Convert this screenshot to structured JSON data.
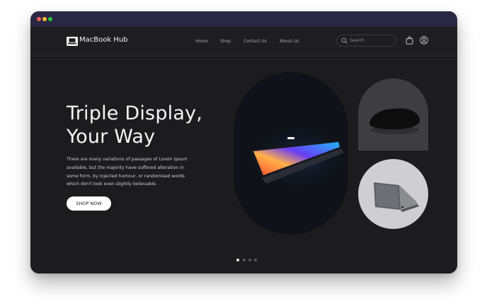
{
  "brand": {
    "name": "MacBook Hub",
    "logo_icon": "laptop-badge-icon"
  },
  "nav": {
    "links": [
      "Home",
      "Shop",
      "Contact Us",
      "About Us"
    ],
    "search_placeholder": "Search",
    "icons": [
      "search-icon",
      "shopping-bag-icon",
      "user-circle-icon"
    ]
  },
  "hero": {
    "title_line1": "Triple Display,",
    "title_line2": "Your Way",
    "description": "There are many variations of passages of Lorem Ipsum available, but the majority have suffered alteration in some form, by injected humour, or randomised words which don't look even slightly believable.",
    "cta_label": "SHOP NOW"
  },
  "carousel": {
    "slide_count": 4,
    "active_index": 0
  },
  "colors": {
    "titlebar": "#2a2743",
    "background": "#1c1c1e",
    "text_primary": "#f5f5f5",
    "button": "#ffffff"
  }
}
